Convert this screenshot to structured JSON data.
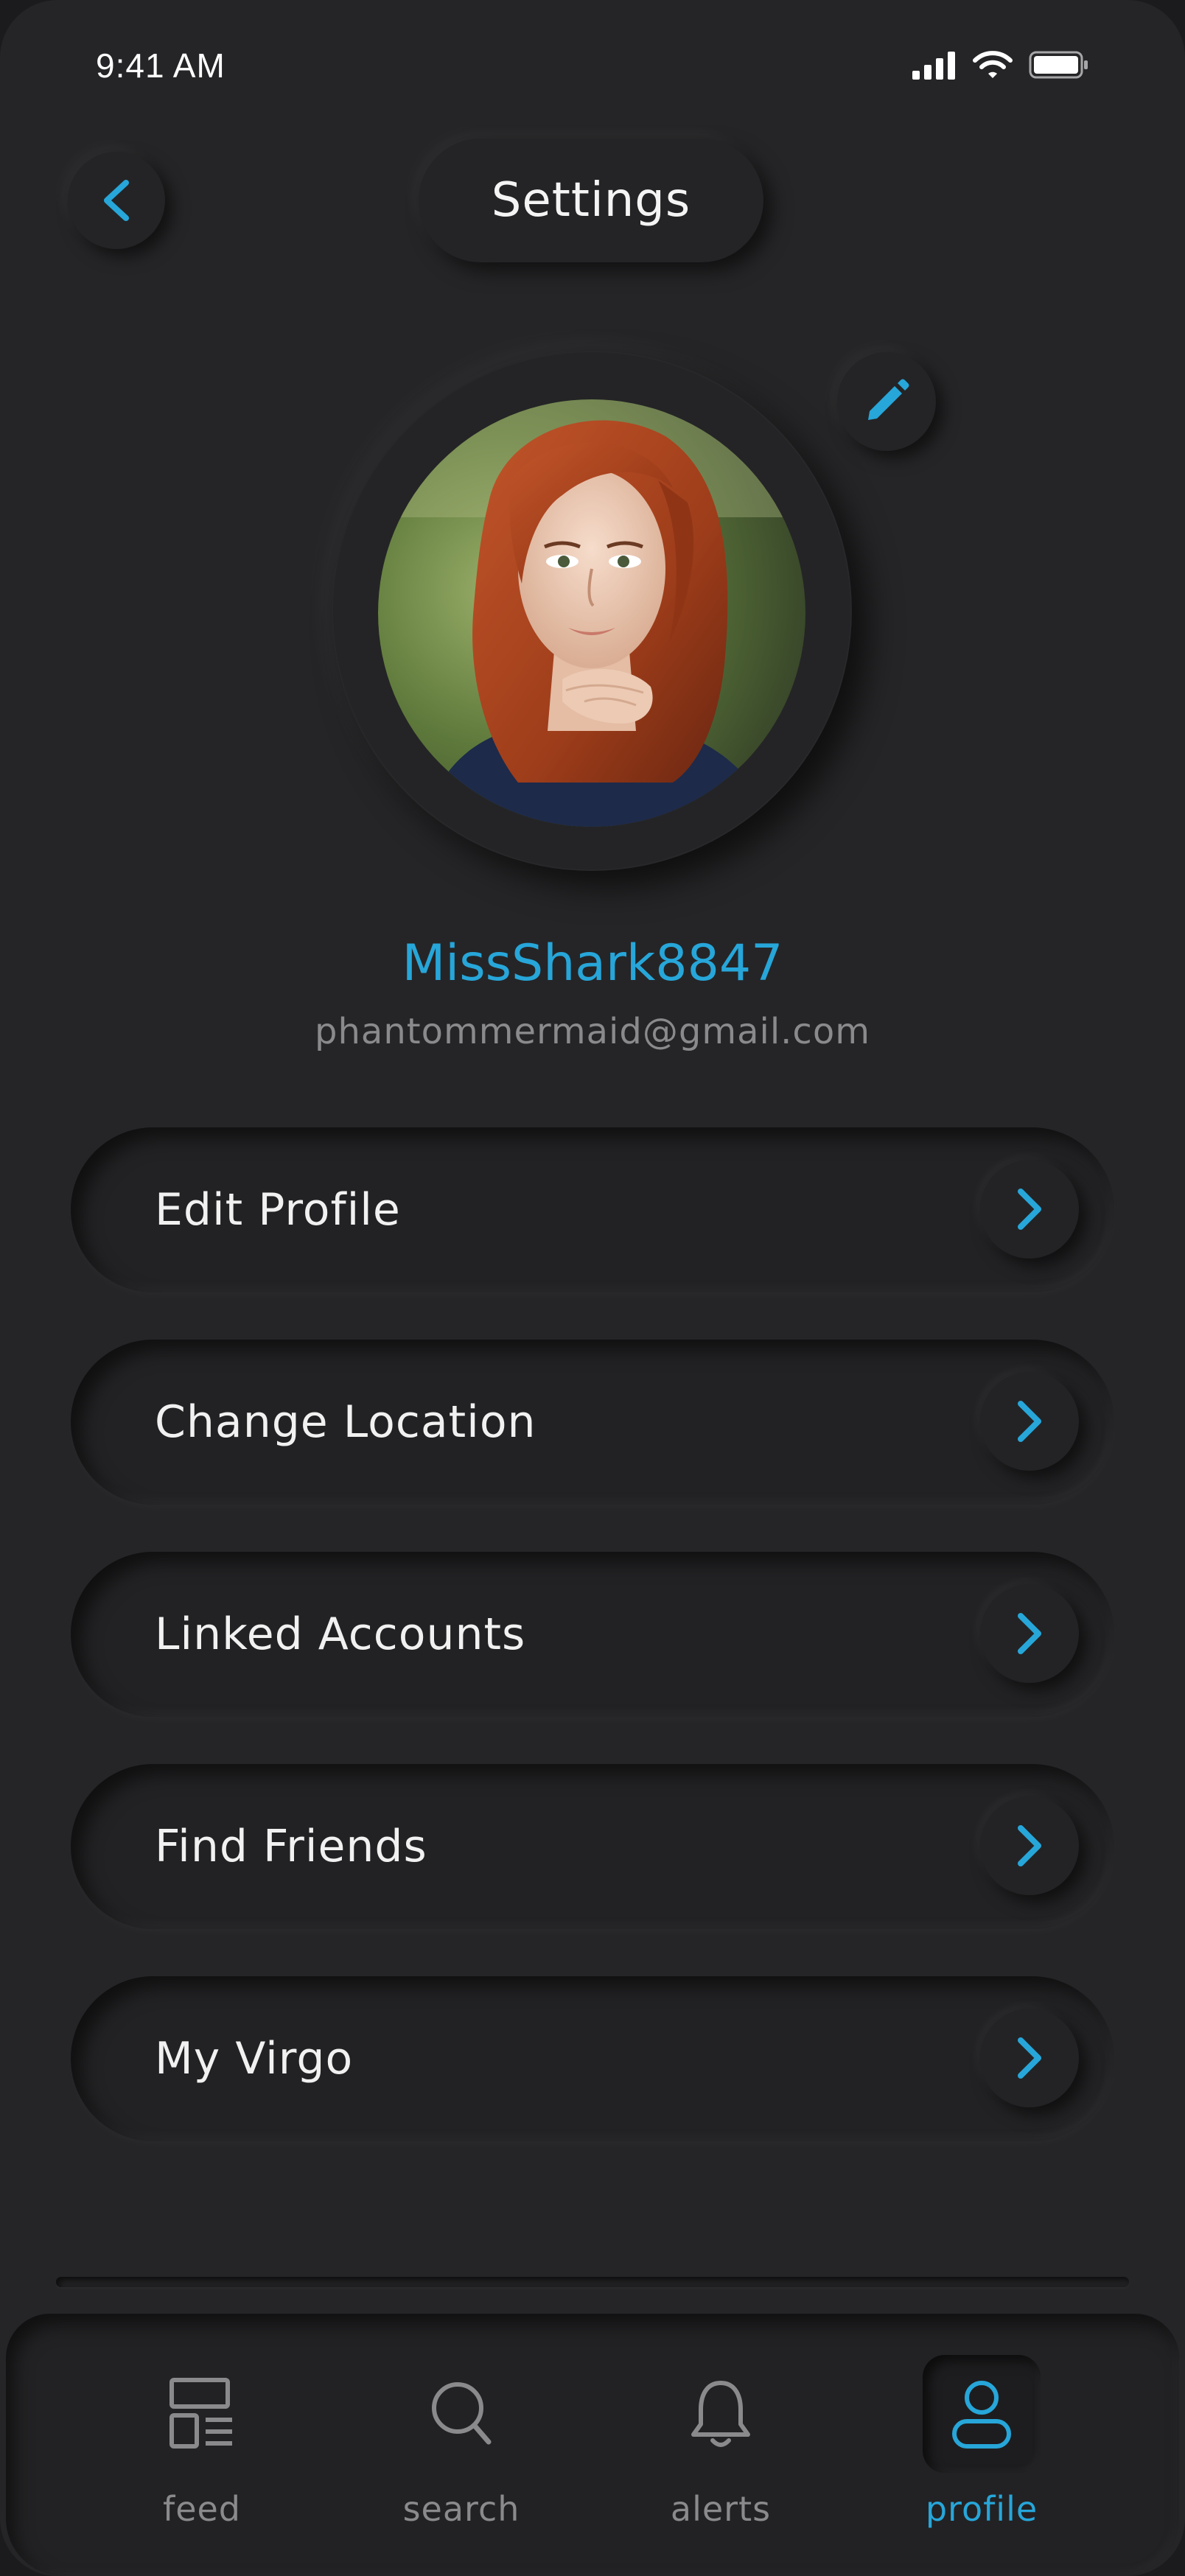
{
  "status_bar": {
    "time": "9:41 AM",
    "icons": [
      "cellular-signal-icon",
      "wifi-icon",
      "battery-icon"
    ]
  },
  "header": {
    "title": "Settings",
    "back_icon": "chevron-left-icon"
  },
  "profile": {
    "username": "MissShark8847",
    "email": "phantommermaid@gmail.com",
    "edit_icon": "pencil-icon"
  },
  "menu": {
    "items": [
      {
        "label": "Edit Profile",
        "icon": "chevron-right-icon"
      },
      {
        "label": "Change Location",
        "icon": "chevron-right-icon"
      },
      {
        "label": "Linked Accounts",
        "icon": "chevron-right-icon"
      },
      {
        "label": "Find Friends",
        "icon": "chevron-right-icon"
      },
      {
        "label": "My Virgo",
        "icon": "chevron-right-icon"
      }
    ]
  },
  "tabbar": {
    "tabs": [
      {
        "label": "feed",
        "icon": "feed-icon",
        "active": false
      },
      {
        "label": "search",
        "icon": "search-icon",
        "active": false
      },
      {
        "label": "alerts",
        "icon": "bell-icon",
        "active": false
      },
      {
        "label": "profile",
        "icon": "user-icon",
        "active": true
      }
    ]
  },
  "colors": {
    "background": "#252527",
    "accent": "#27a6d9",
    "text_primary": "#f1f1f1",
    "text_secondary": "#8a8a8c"
  }
}
